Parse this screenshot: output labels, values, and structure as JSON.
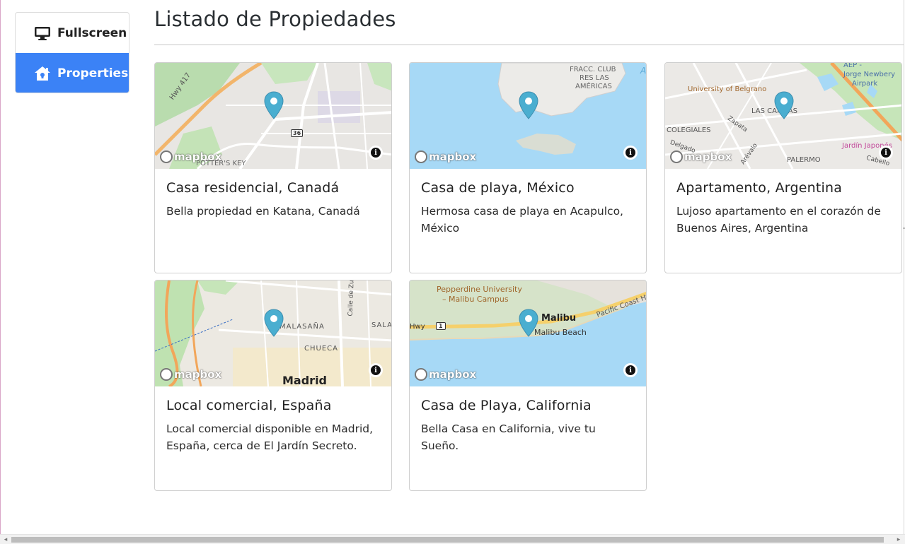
{
  "sidebar": {
    "items": [
      {
        "label": "Fullscreen",
        "icon": "monitor-icon"
      },
      {
        "label": "Properties",
        "icon": "house-icon",
        "active": true
      }
    ],
    "accent": "#3b82f6"
  },
  "page": {
    "title": "Listado de Propiedades"
  },
  "properties": [
    {
      "title": "Casa residencial, Canadá",
      "description": "Bella propiedad en Katana, Canadá",
      "map_labels": [
        "Hwy 417",
        "36",
        "POTTER'S KEY"
      ]
    },
    {
      "title": "Casa de playa, México",
      "description": "Hermosa casa de playa en Acapulco, México",
      "map_labels": [
        "FRACC. CLUB",
        "RES LAS",
        "AMÉRICAS",
        "A"
      ]
    },
    {
      "title": "Apartamento, Argentina",
      "description": "Lujoso apartamento en el corazón de Buenos Aires, Argentina",
      "map_labels": [
        "AEP -",
        "Jorge Newbery",
        "Airpark",
        "University of Belgrano",
        "LAS CAÑITAS",
        "COLEGIALES",
        "Zapata",
        "Delgado",
        "Arévalo",
        "PALERMO",
        "Jardín Japonés",
        "Cabello"
      ]
    },
    {
      "title": "Local comercial, España",
      "description": "Local comercial disponible en Madrid, España, cerca de El Jardín Secreto.",
      "map_labels": [
        "MALASAÑA",
        "CHUECA",
        "SALA",
        "Madrid",
        "Calle de Zu"
      ]
    },
    {
      "title": "Casa de Playa, California",
      "description": "Bella Casa en California, vive tu Sueño.",
      "map_labels": [
        "Pepperdine University",
        "– Malibu Campus",
        "Malibu",
        "Malibu Beach",
        "Pacific Coast Hw",
        "Hwy",
        "1"
      ]
    }
  ],
  "map_attribution": {
    "logo_text": "mapbox",
    "info_symbol": "i"
  }
}
